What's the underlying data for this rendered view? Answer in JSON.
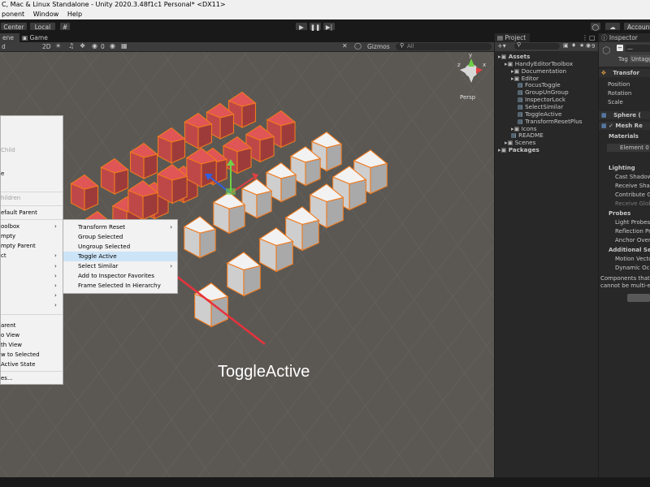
{
  "window": {
    "title": "C, Mac & Linux Standalone - Unity 2020.3.48f1c1 Personal* <DX11>",
    "menu": [
      "ponent",
      "Window",
      "Help"
    ]
  },
  "toolbar": {
    "pivot_label": "Center",
    "space_label": "Local",
    "account_label": "Account"
  },
  "scene_view": {
    "tabs": [
      "ene",
      "Game"
    ],
    "shading_label": "d",
    "mode_2d": "2D",
    "gizmos_label": "Gizmos",
    "search_placeholder": "All",
    "effects_count": "0",
    "persp_label": "Persp",
    "gizmo_axes": {
      "x": "x",
      "y": "y",
      "z": "z"
    }
  },
  "context_menu": {
    "items": [
      {
        "label": "Child",
        "disabled": true
      },
      {
        "label": "e",
        "disabled": false
      },
      {
        "label": "hildren",
        "disabled": true
      },
      {
        "label": "efault Parent",
        "disabled": false
      },
      {
        "label": "oolbox",
        "disabled": false,
        "submenu": true
      },
      {
        "label": "mpty",
        "disabled": false
      },
      {
        "label": "mpty Parent",
        "disabled": false
      },
      {
        "label": "ct",
        "disabled": false,
        "submenu": true
      },
      {
        "label": "arent",
        "disabled": false
      },
      {
        "label": "o View",
        "disabled": false
      },
      {
        "label": "th View",
        "disabled": false
      },
      {
        "label": "w to Selected",
        "disabled": false
      },
      {
        "label": "Active State",
        "disabled": false
      },
      {
        "label": "es...",
        "disabled": false
      }
    ]
  },
  "submenu": {
    "items": [
      {
        "label": "Transform Reset",
        "submenu": true
      },
      {
        "label": "Group Selected"
      },
      {
        "label": "Ungroup Selected"
      },
      {
        "label": "Toggle Active",
        "highlighted": true
      },
      {
        "label": "Select Similar",
        "submenu": true
      },
      {
        "label": "Add to Inspector Favorites"
      },
      {
        "label": "Frame Selected In Hierarchy"
      }
    ]
  },
  "annotation": {
    "text": "ToggleActive",
    "arrow_color": "#e8323c"
  },
  "project": {
    "tab": "Project",
    "count": "9",
    "search_placeholder": "",
    "tree": [
      {
        "label": "Assets",
        "depth": 0,
        "bold": true
      },
      {
        "label": "HandyEditorToolbox",
        "depth": 1
      },
      {
        "label": "Documentation",
        "depth": 2
      },
      {
        "label": "Editor",
        "depth": 2
      },
      {
        "label": "FocusToggle",
        "depth": 3
      },
      {
        "label": "GroupUnGroup",
        "depth": 3
      },
      {
        "label": "InspectorLock",
        "depth": 3
      },
      {
        "label": "SelectSimilar",
        "depth": 3
      },
      {
        "label": "ToggleActive",
        "depth": 3
      },
      {
        "label": "TransformResetPlus",
        "depth": 3
      },
      {
        "label": "Icons",
        "depth": 2
      },
      {
        "label": "README",
        "depth": 2
      },
      {
        "label": "Scenes",
        "depth": 1
      },
      {
        "label": "Packages",
        "depth": 0,
        "bold": true
      }
    ]
  },
  "inspector": {
    "tab": "Inspector",
    "tag_label": "Tag",
    "tag_value": "Untagg",
    "name_value": "—",
    "transform_header": "Transfor",
    "transform_fields": [
      "Position",
      "Rotation",
      "Scale"
    ],
    "sphere_header": "Sphere (",
    "mesh_header": "Mesh Re",
    "materials_label": "Materials",
    "element_label": "Element 0",
    "lighting_label": "Lighting",
    "lighting_fields": [
      "Cast Shadow",
      "Receive Shad",
      "Contribute Gl",
      "Receive Globa"
    ],
    "probes_label": "Probes",
    "probes_fields": [
      "Light Probes",
      "Reflection Pro",
      "Anchor Overri"
    ],
    "additional_label": "Additional Setti",
    "additional_fields": [
      "Motion Vector",
      "Dynamic Occl"
    ],
    "note": [
      "Components that ar",
      "cannot be multi-edit"
    ]
  },
  "colors": {
    "cube_red": "#e05555",
    "cube_white": "#f2f2f2",
    "selection_outline": "#f07a1e",
    "menu_highlight": "#cce4f7"
  }
}
